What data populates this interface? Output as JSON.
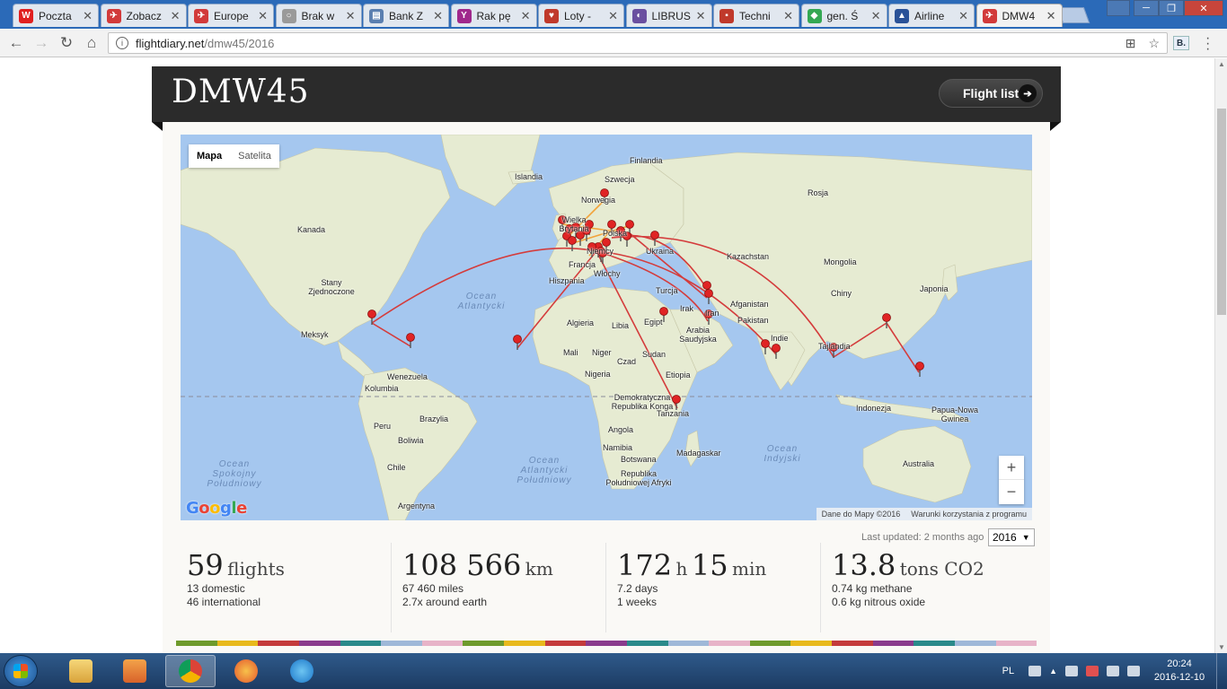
{
  "browser": {
    "tabs": [
      {
        "title": "Poczta",
        "color": "#e02020",
        "glyph": "W"
      },
      {
        "title": "Zobacz",
        "color": "#d23a3a",
        "glyph": "✈"
      },
      {
        "title": "Europe",
        "color": "#d23a3a",
        "glyph": "✈"
      },
      {
        "title": "Brak w",
        "color": "#9a9a9a",
        "glyph": "○"
      },
      {
        "title": "Bank Z",
        "color": "#5a7fb0",
        "glyph": "▤"
      },
      {
        "title": "Rak pę",
        "color": "#a0288c",
        "glyph": "Y"
      },
      {
        "title": "Loty -",
        "color": "#c0392b",
        "glyph": "♥"
      },
      {
        "title": "LIBRUS",
        "color": "#6a4fa0",
        "glyph": "◐"
      },
      {
        "title": "Techni",
        "color": "#c0392b",
        "glyph": "▪"
      },
      {
        "title": "gen. Ś",
        "color": "#34a853",
        "glyph": "◆"
      },
      {
        "title": "Airline",
        "color": "#2a5298",
        "glyph": "▲"
      },
      {
        "title": "DMW4",
        "color": "#d23a3a",
        "glyph": "✈"
      }
    ],
    "url_domain": "flightdiary.net",
    "url_path": "/dmw45/2016",
    "ext_label": "B."
  },
  "header": {
    "title": "DMW45",
    "flight_list_label": "Flight list"
  },
  "map": {
    "type_map": "Mapa",
    "type_satellite": "Satelita",
    "attribution_data": "Dane do Mapy ©2016",
    "attribution_terms": "Warunki korzystania z programu",
    "google": "Google",
    "zoom_in": "+",
    "zoom_out": "−",
    "labels": [
      {
        "t": "Islandia"
      },
      {
        "t": "Finlandia"
      },
      {
        "t": "Szwecja"
      },
      {
        "t": "Norwegia"
      },
      {
        "t": "Rosja"
      },
      {
        "t": "Wielka Brytania"
      },
      {
        "t": "Polska"
      },
      {
        "t": "Niemcy"
      },
      {
        "t": "Ukraina"
      },
      {
        "t": "Kazachstan"
      },
      {
        "t": "Francja"
      },
      {
        "t": "Hiszpania"
      },
      {
        "t": "Włochy"
      },
      {
        "t": "Turcja"
      },
      {
        "t": "Mongolia"
      },
      {
        "t": "Kanada"
      },
      {
        "t": "Stany Zjednoczone"
      },
      {
        "t": "Meksyk"
      },
      {
        "t": "Chiny"
      },
      {
        "t": "Japonia"
      },
      {
        "t": "Afganistan"
      },
      {
        "t": "Irak"
      },
      {
        "t": "Iran"
      },
      {
        "t": "Pakistan"
      },
      {
        "t": "Indie"
      },
      {
        "t": "Algieria"
      },
      {
        "t": "Libia"
      },
      {
        "t": "Egipt"
      },
      {
        "t": "Arabia Saudyjska"
      },
      {
        "t": "Mali"
      },
      {
        "t": "Niger"
      },
      {
        "t": "Czad"
      },
      {
        "t": "Sudan"
      },
      {
        "t": "Nigeria"
      },
      {
        "t": "Etiopia"
      },
      {
        "t": "Tajlandia"
      },
      {
        "t": "Wenezuela"
      },
      {
        "t": "Kolumbia"
      },
      {
        "t": "Peru"
      },
      {
        "t": "Brazylia"
      },
      {
        "t": "Boliwia"
      },
      {
        "t": "Chile"
      },
      {
        "t": "Argentyna"
      },
      {
        "t": "Demokratyczna Republika Konga"
      },
      {
        "t": "Tanzania"
      },
      {
        "t": "Angola"
      },
      {
        "t": "Namibia"
      },
      {
        "t": "Botswana"
      },
      {
        "t": "Madagaskar"
      },
      {
        "t": "Republika Południowej Afryki"
      },
      {
        "t": "Indonezja"
      },
      {
        "t": "Papua-Nowa Gwinea"
      },
      {
        "t": "Australia"
      }
    ],
    "oceans": [
      {
        "t": "Ocean Atlantycki"
      },
      {
        "t": "Ocean Spokojny Południowy"
      },
      {
        "t": "Ocean Atlantycki Południowy"
      },
      {
        "t": "Ocean Indyjski"
      }
    ]
  },
  "stats": {
    "last_updated": "Last updated: 2 months ago",
    "year": "2016",
    "flights": {
      "value": "59",
      "unit": "flights",
      "line1": "13 domestic",
      "line2": "46 international"
    },
    "distance": {
      "value": "108 566",
      "unit": "km",
      "line1": "67 460 miles",
      "line2": "2.7x around earth"
    },
    "time": {
      "hours": "172",
      "h": "h",
      "minutes": "15",
      "min": "min",
      "line1": "7.2 days",
      "line2": "1 weeks"
    },
    "co2": {
      "value": "13.8",
      "unit": "tons CO2",
      "line1": "0.74 kg methane",
      "line2": "0.6 kg nitrous oxide"
    }
  },
  "colorbar": [
    "#6e9a2c",
    "#e8b91c",
    "#c43b3b",
    "#8a3b8c",
    "#2a8a8a",
    "#9fb8d8",
    "#e7b3c8",
    "#6e9a2c",
    "#e8b91c",
    "#c43b3b",
    "#8a3b8c",
    "#2a8a8a",
    "#9fb8d8",
    "#e7b3c8",
    "#6e9a2c",
    "#e8b91c",
    "#c43b3b",
    "#8a3b8c",
    "#2a8a8a",
    "#9fb8d8",
    "#e7b3c8"
  ],
  "taskbar": {
    "lang": "PL",
    "time": "20:24",
    "date": "2016-12-10"
  }
}
